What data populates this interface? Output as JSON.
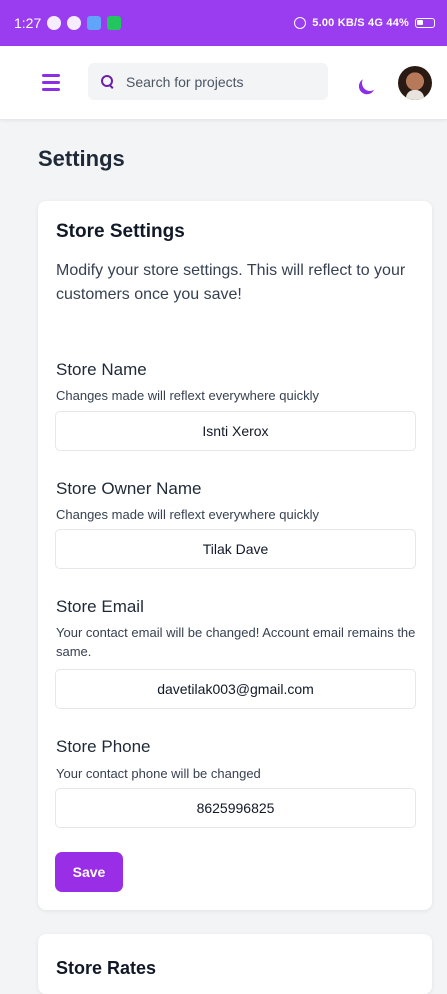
{
  "status_bar": {
    "time": "1:27",
    "right_text": "5.00 KB/S  4G  44%"
  },
  "header": {
    "search_placeholder": "Search for projects"
  },
  "page": {
    "title": "Settings"
  },
  "store_settings": {
    "title": "Store Settings",
    "description": "Modify your store settings. This will reflect to your customers once you save!",
    "fields": [
      {
        "label": "Store Name",
        "help": "Changes made will reflext everywhere quickly",
        "value": "Isnti Xerox"
      },
      {
        "label": "Store Owner Name",
        "help": "Changes made will reflext everywhere quickly",
        "value": "Tilak Dave"
      },
      {
        "label": "Store Email",
        "help": "Your contact email will be changed! Account email remains the same.",
        "value": "davetilak003@gmail.com"
      },
      {
        "label": "Store Phone",
        "help": "Your contact phone will be changed",
        "value": "8625996825"
      }
    ],
    "save_label": "Save"
  },
  "store_rates": {
    "title": "Store Rates"
  },
  "colors": {
    "accent": "#9a2ee6",
    "status_bar": "#9a3cf0"
  },
  "icons": [
    "whatsapp-icon",
    "shield-icon",
    "app-icon",
    "message-icon",
    "alarm-icon",
    "bluetooth-icon",
    "signal-icon",
    "battery-icon",
    "menu-icon",
    "search-icon",
    "moon-icon"
  ]
}
